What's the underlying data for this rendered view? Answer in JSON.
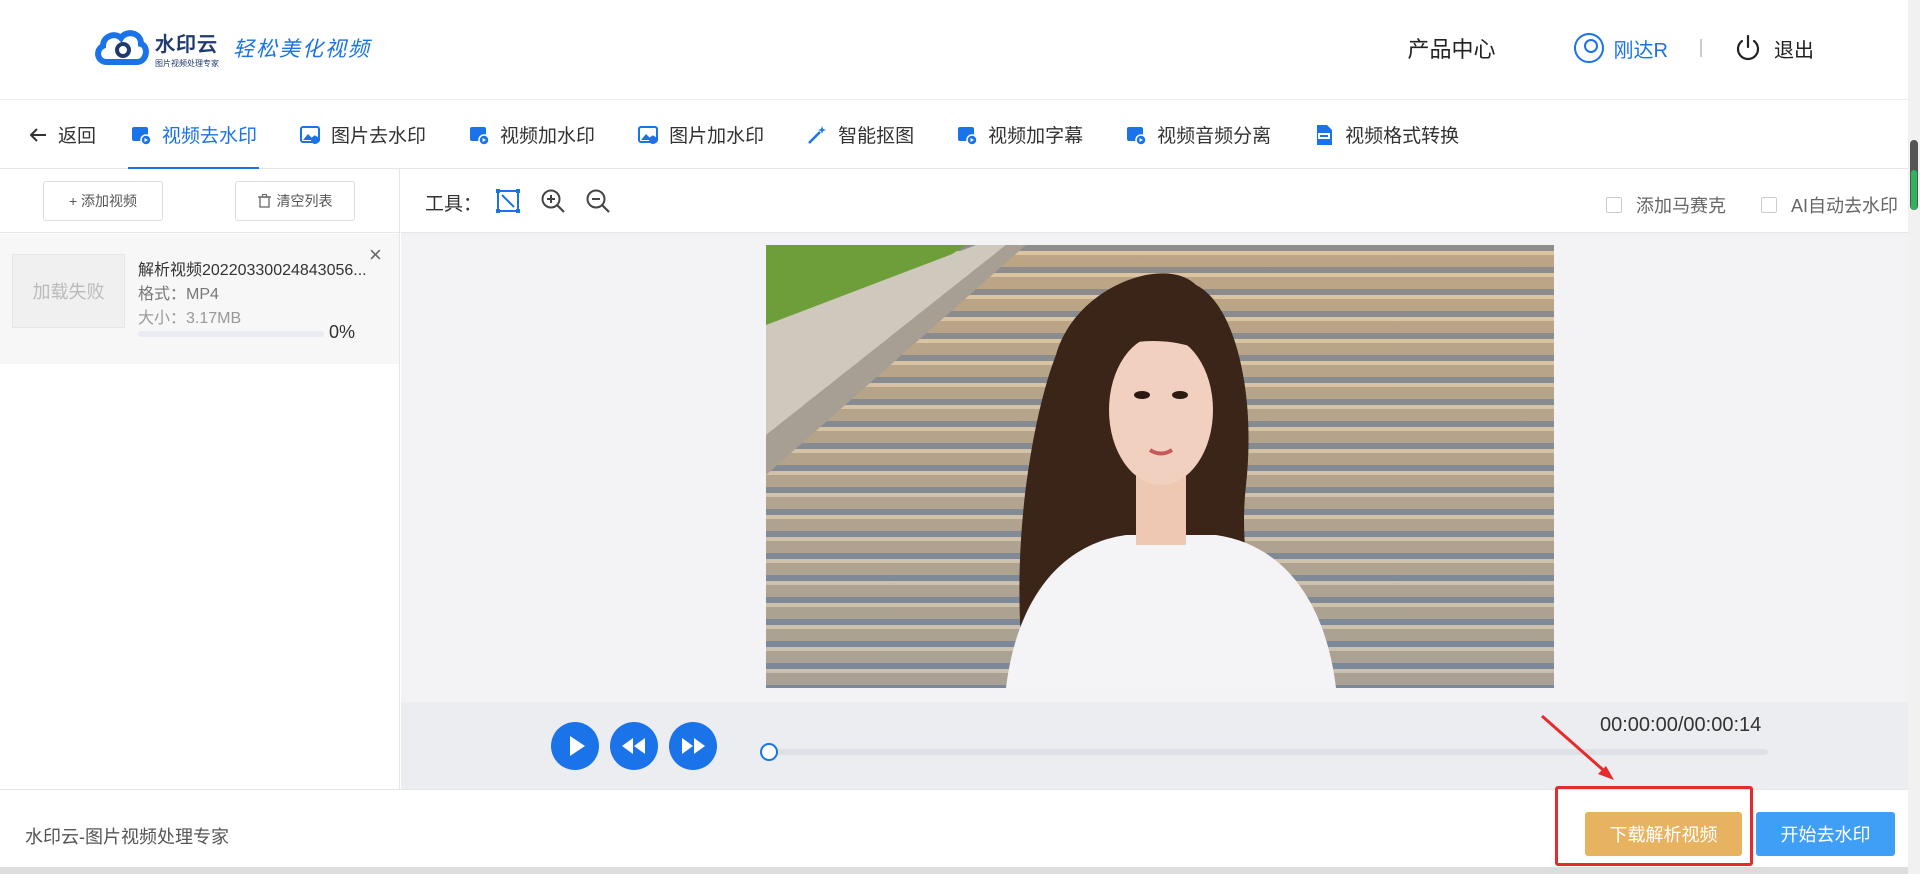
{
  "header": {
    "logo_name": "水印云",
    "logo_sub": "图片视频处理专家",
    "slogan": "轻松美化视频",
    "product_center": "产品中心",
    "username": "刚达R",
    "logout": "退出"
  },
  "tabs": {
    "back": "返回",
    "items": [
      {
        "label": "视频去水印",
        "icon": "video-icon",
        "active": true
      },
      {
        "label": "图片去水印",
        "icon": "image-icon"
      },
      {
        "label": "视频加水印",
        "icon": "video-icon"
      },
      {
        "label": "图片加水印",
        "icon": "image-icon"
      },
      {
        "label": "智能抠图",
        "icon": "magic-wand-icon"
      },
      {
        "label": "视频加字幕",
        "icon": "video-icon"
      },
      {
        "label": "视频音频分离",
        "icon": "video-icon"
      },
      {
        "label": "视频格式转换",
        "icon": "mp4-file-icon"
      }
    ]
  },
  "sidebar": {
    "add_video": "+ 添加视频",
    "clear_list": "清空列表",
    "item": {
      "thumb_text": "加载失败",
      "name": "解析视频20220330024843056...",
      "format": "格式：MP4",
      "size": "大小：3.17MB",
      "percent": "0%",
      "progress": 0
    }
  },
  "toolbar": {
    "label": "工具：",
    "add_mosaic": "添加马赛克",
    "ai_remove": "AI自动去水印"
  },
  "player": {
    "time": "00:00:00/00:00:14",
    "progress": 0
  },
  "footer": {
    "text": "水印云-图片视频处理专家",
    "download": "下载解析视频",
    "start": "开始去水印"
  },
  "colors": {
    "accent": "#1a73e8",
    "download_button": "#e8b360",
    "start_button": "#3f9ff7",
    "annotation": "#e52b2b"
  }
}
